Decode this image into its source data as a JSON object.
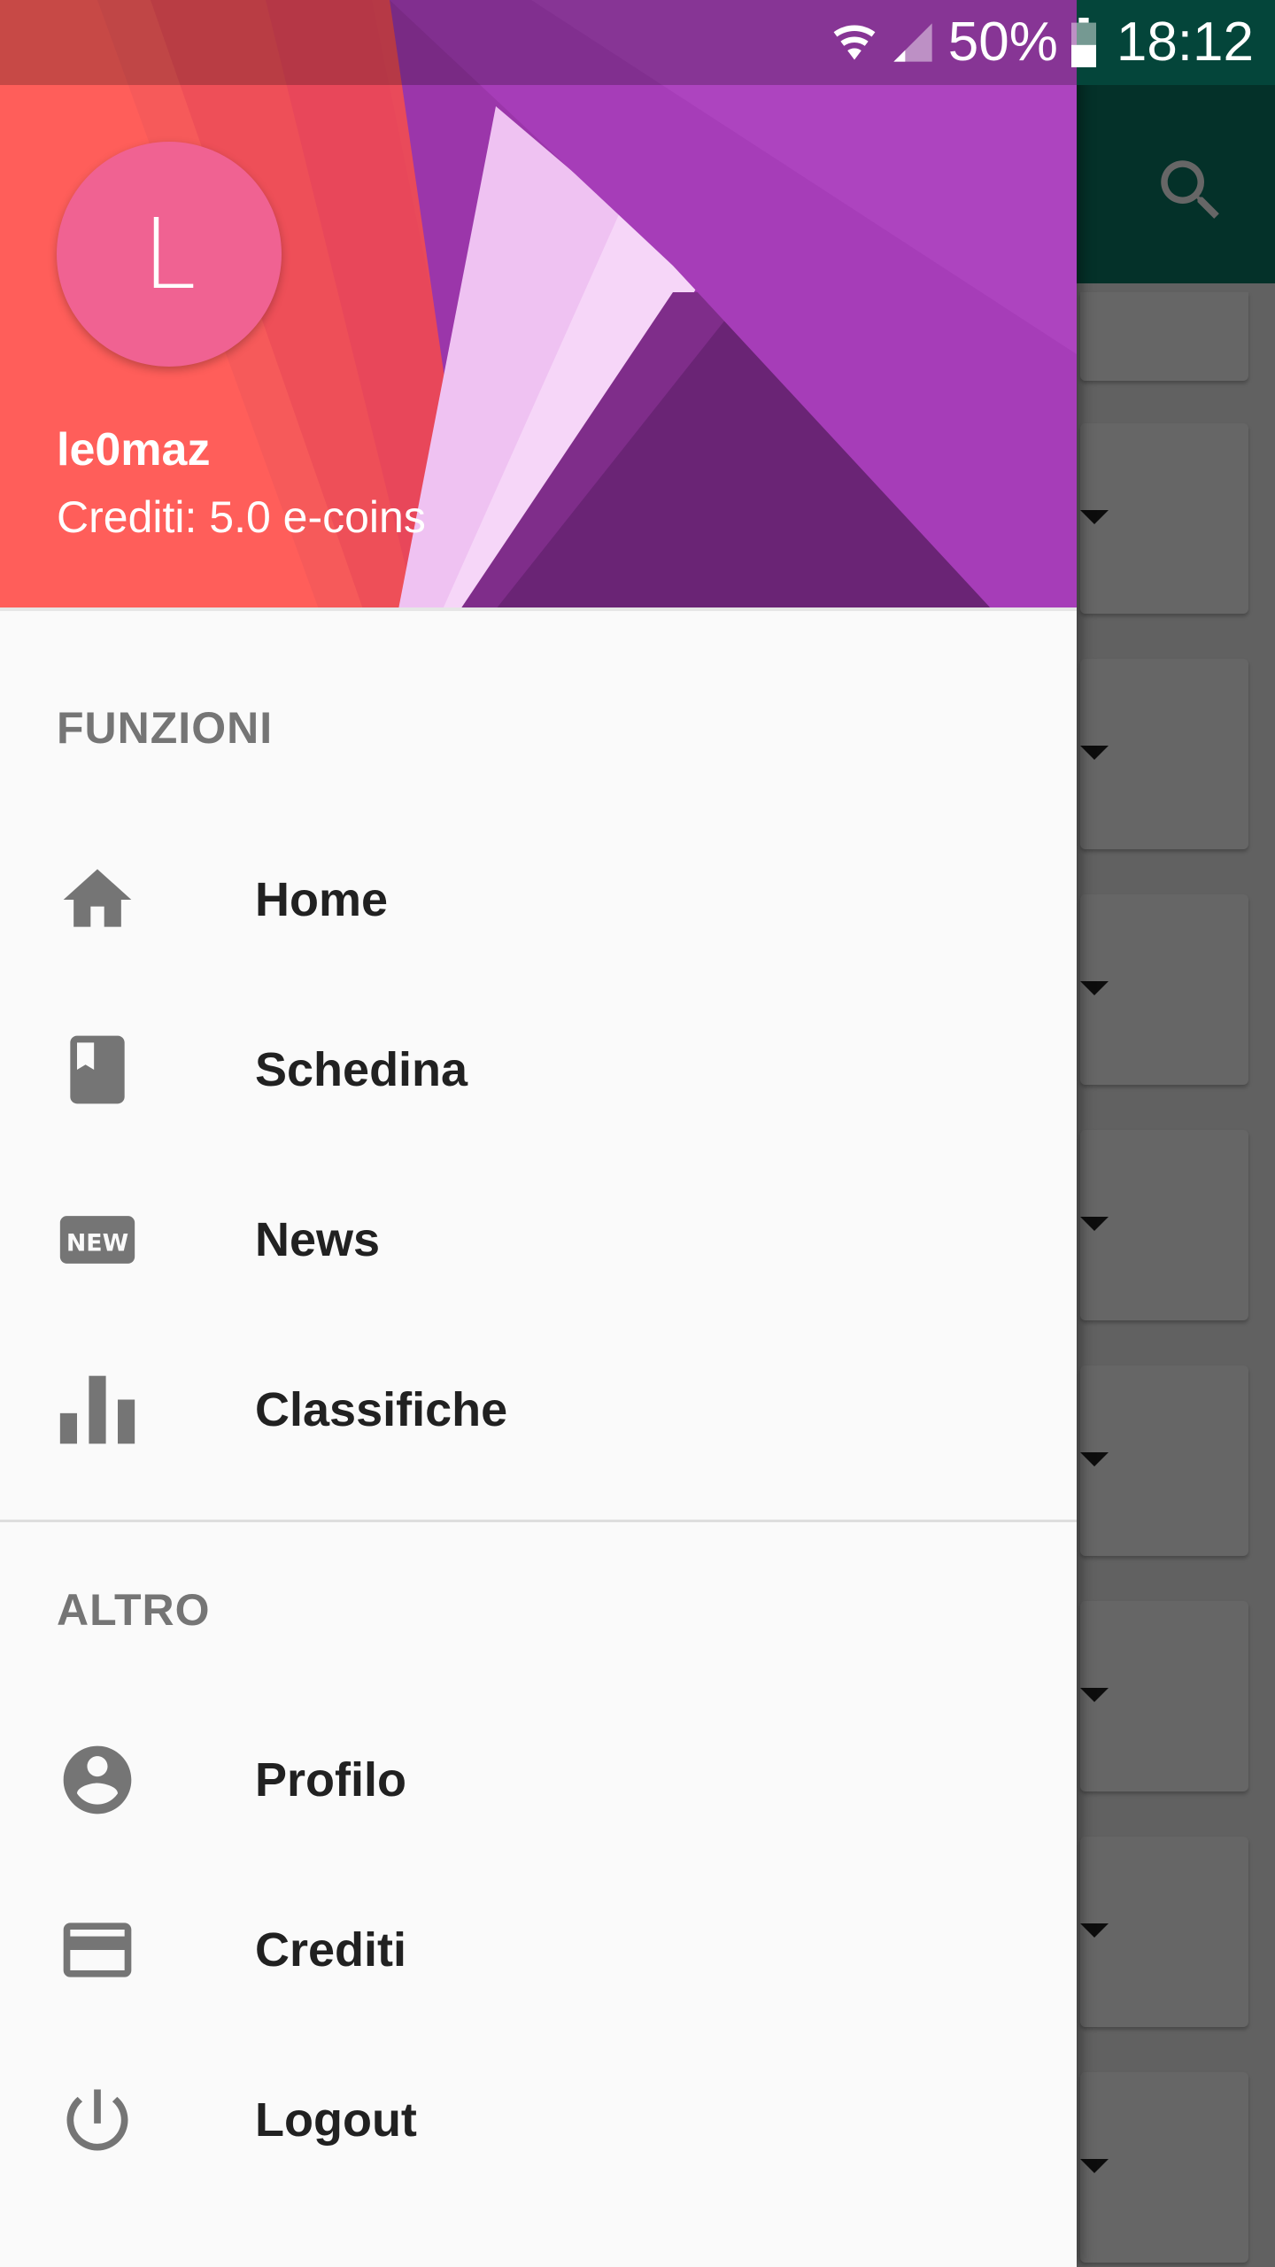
{
  "status_bar": {
    "battery_percent": "50%",
    "time": "18:12",
    "icons": [
      "wifi-icon",
      "cellular-signal-icon",
      "battery-icon"
    ]
  },
  "background_app": {
    "appbar_color": "#0a7a66",
    "icons": [
      "search-icon",
      "chevron-down-icon"
    ]
  },
  "drawer": {
    "header": {
      "avatar_letter": "L",
      "avatar_color": "#f06292",
      "username": "le0maz",
      "credits": "Crediti: 5.0 e-coins"
    },
    "sections": [
      {
        "title": "FUNZIONI",
        "items": [
          {
            "label": "Home",
            "icon": "home-icon"
          },
          {
            "label": "Schedina",
            "icon": "book-icon"
          },
          {
            "label": "News",
            "icon": "new-badge-icon"
          },
          {
            "label": "Classifiche",
            "icon": "bar-chart-icon"
          }
        ]
      },
      {
        "title": "ALTRO",
        "items": [
          {
            "label": "Profilo",
            "icon": "account-circle-icon"
          },
          {
            "label": "Crediti",
            "icon": "credit-card-icon"
          },
          {
            "label": "Logout",
            "icon": "power-icon"
          }
        ]
      }
    ],
    "icon_color": "#757575",
    "text_color": "#212121"
  }
}
